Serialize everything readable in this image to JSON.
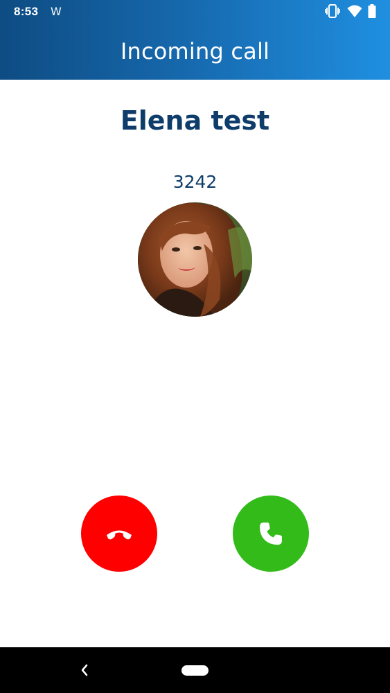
{
  "status_bar": {
    "time": "8:53",
    "notification_icon": "W",
    "icons": [
      "vibrate-icon",
      "wifi-icon",
      "battery-icon"
    ]
  },
  "header": {
    "title": "Incoming call",
    "gradient_colors": [
      "#0e4c83",
      "#1f8fe0"
    ]
  },
  "caller": {
    "name": "Elena test",
    "number": "3242",
    "avatar": "caller-photo"
  },
  "actions": {
    "decline": {
      "icon": "phone-hangup-icon",
      "color": "#ff0000"
    },
    "answer": {
      "icon": "phone-icon",
      "color": "#33bb1a"
    }
  },
  "nav_bar": {
    "icons": [
      "back-icon",
      "home-pill"
    ]
  },
  "colors": {
    "text_primary": "#0e3d6b",
    "background": "#ffffff"
  }
}
